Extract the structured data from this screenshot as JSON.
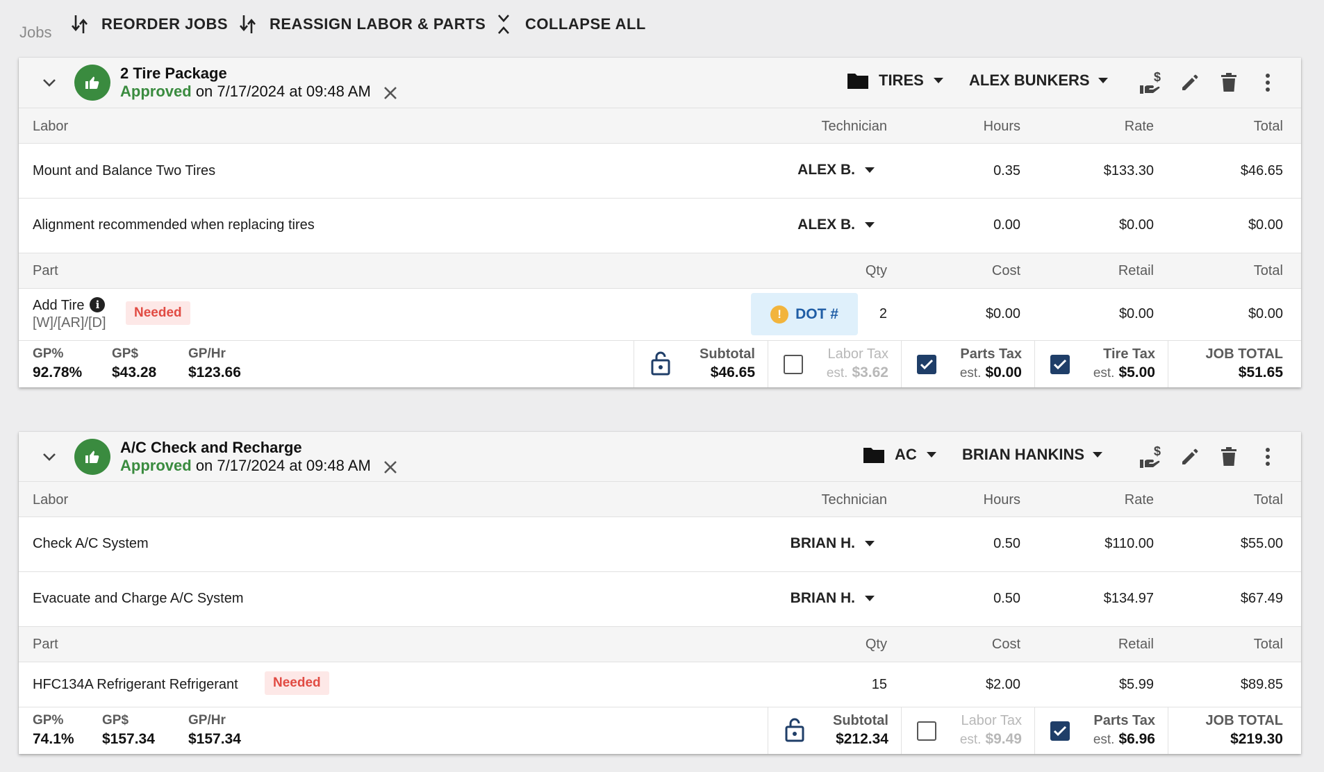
{
  "toolbar": {
    "section_label": "Jobs",
    "reorder_label": "REORDER JOBS",
    "reassign_label": "REASSIGN LABOR & PARTS",
    "collapse_label": "COLLAPSE ALL"
  },
  "columns": {
    "labor": "Labor",
    "technician": "Technician",
    "hours": "Hours",
    "rate": "Rate",
    "total": "Total",
    "part": "Part",
    "qty": "Qty",
    "cost": "Cost",
    "retail": "Retail"
  },
  "footer_labels": {
    "gp_pct": "GP%",
    "gp_dollar": "GP$",
    "gp_hr": "GP/Hr",
    "subtotal": "Subtotal",
    "labor_tax": "Labor Tax",
    "parts_tax": "Parts Tax",
    "tire_tax": "Tire Tax",
    "est": "est.",
    "job_total": "JOB TOTAL"
  },
  "colors": {
    "approved_green": "#3a8b3f",
    "needed_red": "#e14b43",
    "checkbox_navy": "#1f3e68",
    "dot_blue": "#1f5da5"
  },
  "jobs": [
    {
      "title": "2 Tire Package",
      "status": "Approved",
      "status_detail": "on 7/17/2024 at 09:48 AM",
      "category": "TIRES",
      "technician": "ALEX BUNKERS",
      "labor": [
        {
          "description": "Mount and Balance Two Tires",
          "tech": "ALEX B.",
          "hours": "0.35",
          "rate": "$133.30",
          "total": "$46.65"
        },
        {
          "description": "Alignment recommended when replacing tires",
          "tech": "ALEX B.",
          "hours": "0.00",
          "rate": "$0.00",
          "total": "$0.00"
        }
      ],
      "parts": [
        {
          "name": "Add Tire",
          "sub": "[W]/[AR]/[D]",
          "badge": "Needed",
          "dot_label": "DOT #",
          "qty": "2",
          "cost": "$0.00",
          "retail": "$0.00",
          "total": "$0.00"
        }
      ],
      "footer": {
        "gp_pct": "92.78%",
        "gp_dollar": "$43.28",
        "gp_hr": "$123.66",
        "subtotal": "$46.65",
        "labor_tax": "$3.62",
        "labor_tax_checked": false,
        "parts_tax": "$0.00",
        "parts_tax_checked": true,
        "tire_tax": "$5.00",
        "tire_tax_checked": true,
        "job_total": "$51.65"
      }
    },
    {
      "title": "A/C Check and Recharge",
      "status": "Approved",
      "status_detail": "on 7/17/2024 at 09:48 AM",
      "category": "AC",
      "technician": "BRIAN HANKINS",
      "labor": [
        {
          "description": "Check A/C System",
          "tech": "BRIAN H.",
          "hours": "0.50",
          "rate": "$110.00",
          "total": "$55.00"
        },
        {
          "description": "Evacuate and Charge A/C System",
          "tech": "BRIAN H.",
          "hours": "0.50",
          "rate": "$134.97",
          "total": "$67.49"
        }
      ],
      "parts": [
        {
          "name": "HFC134A Refrigerant Refrigerant",
          "badge": "Needed",
          "qty": "15",
          "cost": "$2.00",
          "retail": "$5.99",
          "total": "$89.85"
        }
      ],
      "footer": {
        "gp_pct": "74.1%",
        "gp_dollar": "$157.34",
        "gp_hr": "$157.34",
        "subtotal": "$212.34",
        "labor_tax": "$9.49",
        "labor_tax_checked": false,
        "parts_tax": "$6.96",
        "parts_tax_checked": true,
        "job_total": "$219.30"
      }
    }
  ]
}
